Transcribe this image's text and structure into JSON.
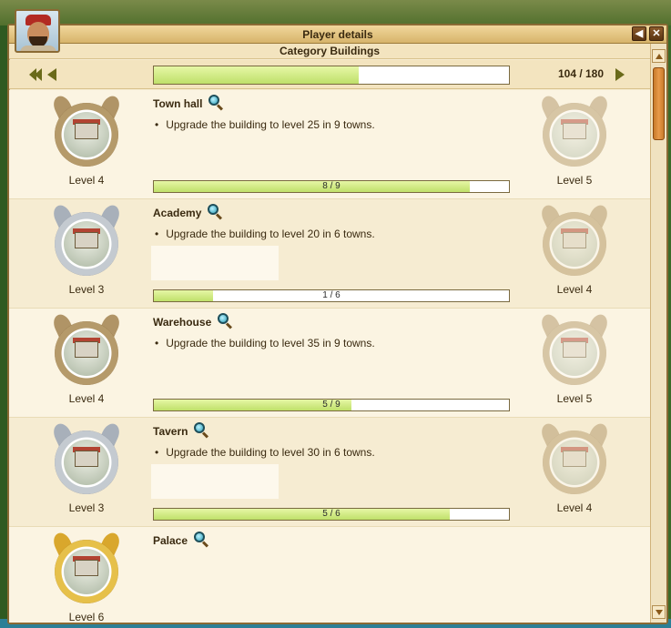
{
  "window": {
    "title": "Player details",
    "subtitle": "Category Buildings",
    "back_icon": "◀",
    "close_icon": "✕"
  },
  "summary": {
    "count": "104 / 180",
    "progress": 0.578
  },
  "buildings": [
    {
      "name": "Town hall",
      "task": "Upgrade the building to level 25 in 9 towns.",
      "current_level": "Level 4",
      "next_level": "Level 5",
      "progress_text": "8 / 9",
      "progress": 0.889,
      "current_medal": "bronze",
      "next_medal": "bronze"
    },
    {
      "name": "Academy",
      "task": "Upgrade the building to level 20 in 6 towns.",
      "current_level": "Level 3",
      "next_level": "Level 4",
      "progress_text": "1 / 6",
      "progress": 0.167,
      "current_medal": "silver",
      "next_medal": "bronze"
    },
    {
      "name": "Warehouse",
      "task": "Upgrade the building to level 35 in 9 towns.",
      "current_level": "Level 4",
      "next_level": "Level 5",
      "progress_text": "5 / 9",
      "progress": 0.556,
      "current_medal": "bronze",
      "next_medal": "bronze"
    },
    {
      "name": "Tavern",
      "task": "Upgrade the building to level 30 in 6 towns.",
      "current_level": "Level 3",
      "next_level": "Level 4",
      "progress_text": "5 / 6",
      "progress": 0.833,
      "current_medal": "silver",
      "next_medal": "bronze"
    },
    {
      "name": "Palace",
      "current_level": "Level 6",
      "current_medal": "gold"
    }
  ]
}
